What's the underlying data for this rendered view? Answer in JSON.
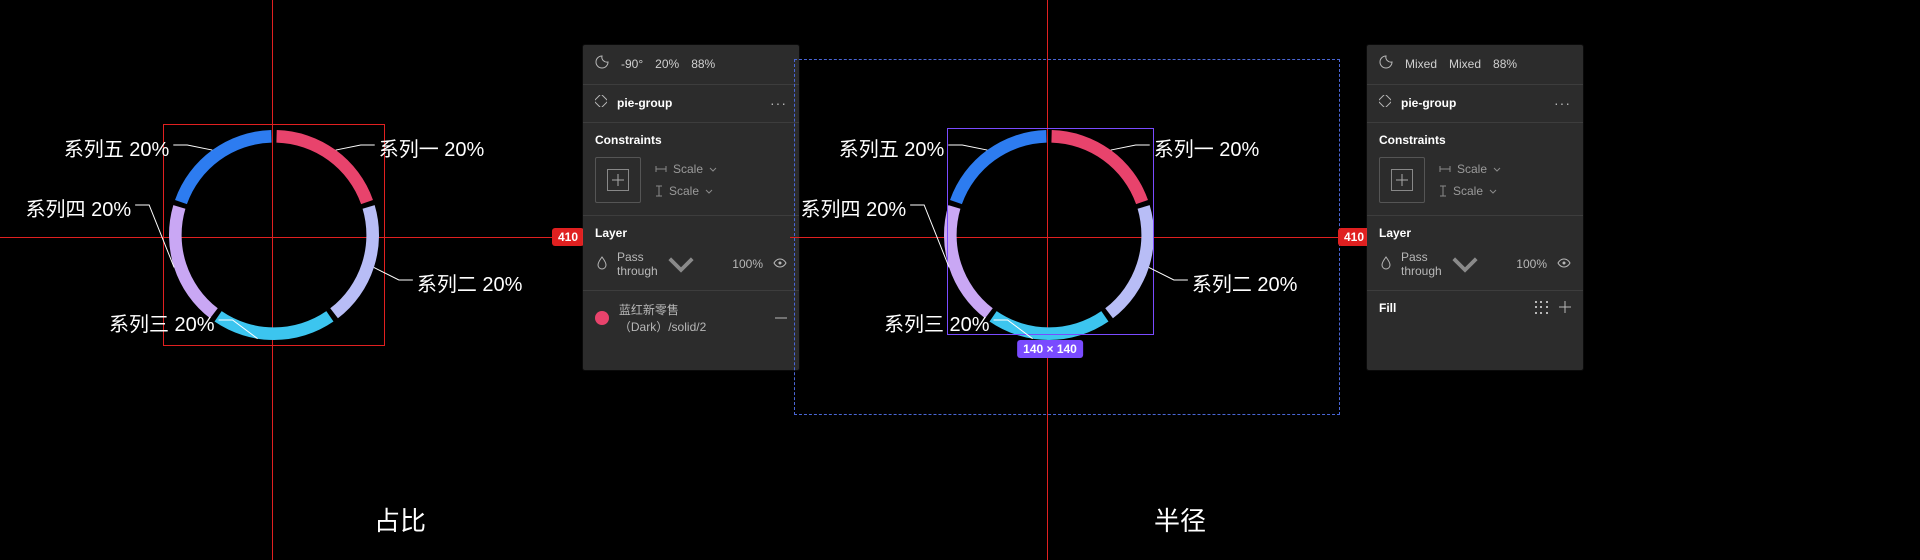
{
  "views": {
    "left": {
      "caption": "占比",
      "dim_right": "410"
    },
    "right": {
      "caption": "半径",
      "dim_right": "410",
      "size_badge": "140 × 140"
    }
  },
  "labels": [
    {
      "name": "系列一",
      "pct": "20%"
    },
    {
      "name": "系列二",
      "pct": "20%"
    },
    {
      "name": "系列三",
      "pct": "20%"
    },
    {
      "name": "系列四",
      "pct": "20%"
    },
    {
      "name": "系列五",
      "pct": "20%"
    }
  ],
  "panel_left": {
    "arc": {
      "angle": "-90°",
      "sweep": "20%",
      "inner": "88%"
    },
    "group_name": "pie-group",
    "constraints": {
      "section": "Constraints",
      "h": "Scale",
      "v": "Scale"
    },
    "layer": {
      "section": "Layer",
      "blend": "Pass through",
      "opacity": "100%"
    },
    "color": {
      "name": "蓝红新零售（Dark）/solid/2"
    }
  },
  "panel_right": {
    "arc": {
      "angle": "Mixed",
      "sweep": "Mixed",
      "inner": "88%"
    },
    "group_name": "pie-group",
    "constraints": {
      "section": "Constraints",
      "h": "Scale",
      "v": "Scale"
    },
    "layer": {
      "section": "Layer",
      "blend": "Pass through",
      "opacity": "100%"
    },
    "fill": {
      "section": "Fill"
    }
  },
  "chart_data": {
    "type": "pie",
    "title": "",
    "series": [
      {
        "name": "系列一",
        "value": 20,
        "color": "#e8436c"
      },
      {
        "name": "系列二",
        "value": 20,
        "color": "#b8bdf6"
      },
      {
        "name": "系列三",
        "value": 20,
        "color": "#3cc5ef"
      },
      {
        "name": "系列四",
        "value": 20,
        "color": "#c9a7f4"
      },
      {
        "name": "系列五",
        "value": 20,
        "color": "#2d7cf0"
      }
    ],
    "inner_radius_pct": 88,
    "start_angle_deg": -90,
    "gap_deg": 3
  }
}
